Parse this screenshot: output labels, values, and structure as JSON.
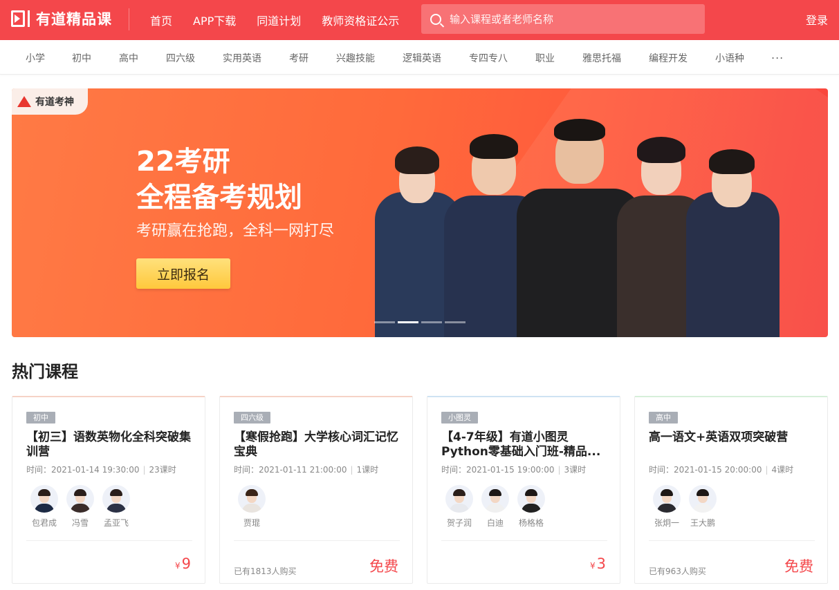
{
  "header": {
    "logo_text": "有道精品课",
    "nav": [
      "首页",
      "APP下载",
      "同道计划",
      "教师资格证公示"
    ],
    "search_placeholder": "输入课程或者老师名称",
    "login_label": "登录"
  },
  "subnav": {
    "items": [
      "小学",
      "初中",
      "高中",
      "四六级",
      "实用英语",
      "考研",
      "兴趣技能",
      "逻辑英语",
      "专四专八",
      "职业",
      "雅思托福",
      "编程开发",
      "小语种"
    ],
    "more": "..."
  },
  "banner": {
    "brand": "有道考神",
    "title_line1": "22考研",
    "title_line2": "全程备考规划",
    "subtitle": "考研赢在抢跑，全科一网打尽",
    "button": "立即报名"
  },
  "section_title": "热门课程",
  "courses": [
    {
      "tag": "初中",
      "title": "【初三】语数英物化全科突破集训营",
      "time_label": "时间：",
      "time": "2021-01-14 19:30:00",
      "lessons": "23课时",
      "teachers": [
        "包君成",
        "冯雪",
        "孟亚飞"
      ],
      "bought": "",
      "price_symbol": "¥",
      "price": "9",
      "accent_color": "#f6d3c6"
    },
    {
      "tag": "四六级",
      "title": "【寒假抢跑】大学核心词汇记忆宝典",
      "time_label": "时间：",
      "time": "2021-01-11 21:00:00",
      "lessons": "1课时",
      "teachers": [
        "贾琨"
      ],
      "bought": "已有1813人购买",
      "price_symbol": "",
      "price": "免费",
      "accent_color": "#f6d3c6"
    },
    {
      "tag": "小图灵",
      "title": "【4-7年级】有道小图灵Python零基础入门班-精品...",
      "time_label": "时间：",
      "time": "2021-01-15 19:00:00",
      "lessons": "3课时",
      "teachers": [
        "贺子润",
        "白迪",
        "杨格格"
      ],
      "bought": "",
      "price_symbol": "¥",
      "price": "3",
      "accent_color": "#cfe3f3"
    },
    {
      "tag": "高中",
      "title": "高一语文+英语双项突破营",
      "time_label": "时间：",
      "time": "2021-01-15 20:00:00",
      "lessons": "4课时",
      "teachers": [
        "张炯一",
        "王大鹏"
      ],
      "bought": "已有963人购买",
      "price_symbol": "",
      "price": "免费",
      "accent_color": "#d6efd9"
    }
  ],
  "colors": {
    "brand": "#f4474b",
    "banner": "#ff6a3b",
    "button": "#ffd156"
  }
}
